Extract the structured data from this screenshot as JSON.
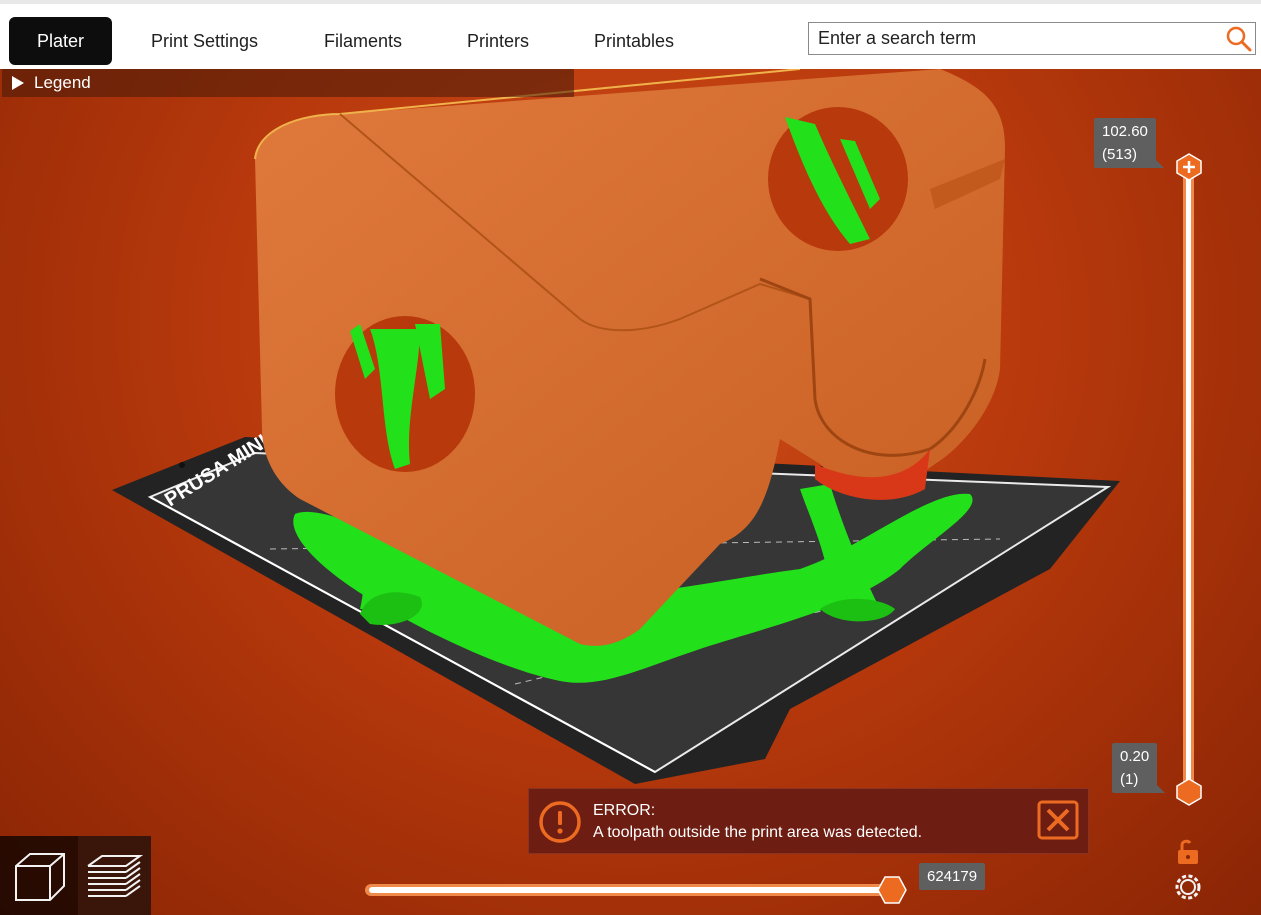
{
  "tabs": [
    {
      "label": "Plater",
      "active": true
    },
    {
      "label": "Print Settings",
      "active": false
    },
    {
      "label": "Filaments",
      "active": false
    },
    {
      "label": "Printers",
      "active": false
    },
    {
      "label": "Printables",
      "active": false
    }
  ],
  "search": {
    "placeholder": "Enter a search term",
    "icon": "search-icon"
  },
  "legend": {
    "label": "Legend"
  },
  "bed_label": "PRUSA MINI",
  "vertical_slider": {
    "top_value": "102.60",
    "top_layer": "(513)",
    "bottom_value": "0.20",
    "bottom_layer": "(1)"
  },
  "horizontal_slider": {
    "value": "624179"
  },
  "error": {
    "title": "ERROR:",
    "message": "A toolpath outside the print area was detected."
  },
  "colors": {
    "accent": "#ed6b21",
    "model": "#d2692c",
    "support": "#22e01a",
    "background": "#b8390c",
    "bed": "#2f2f2f"
  },
  "icons": [
    "search-icon",
    "lock-open-icon",
    "settings-gear-icon",
    "3d-view-icon",
    "layers-view-icon",
    "error-icon",
    "close-icon"
  ]
}
